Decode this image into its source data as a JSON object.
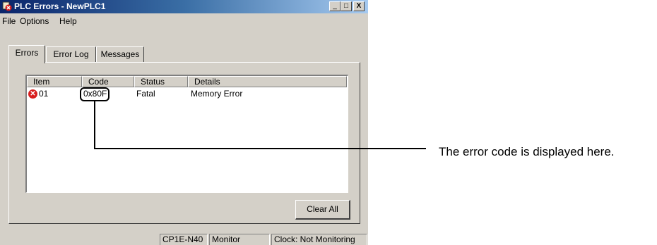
{
  "window": {
    "title": "PLC Errors - NewPLC1",
    "controls": [
      "_",
      "□",
      "X"
    ]
  },
  "menu": [
    "File",
    "Options",
    "Help"
  ],
  "tabs": [
    {
      "label": "Errors",
      "active": true
    },
    {
      "label": "Error Log",
      "active": false
    },
    {
      "label": "Messages",
      "active": false
    }
  ],
  "list": {
    "headers": [
      "Item",
      "Code",
      "Status",
      "Details"
    ],
    "rows": [
      {
        "icon": "error-x-icon",
        "item": "01",
        "code": "0x80F",
        "status": "Fatal",
        "details": "Memory Error"
      }
    ]
  },
  "buttons": {
    "clear_all": "Clear All"
  },
  "statusbar": [
    "CP1E-N40",
    "Monitor",
    "Clock: Not Monitoring"
  ],
  "annotation": "The error code is displayed here.",
  "colors": {
    "titlebar": "#0a246a",
    "face": "#d4d0c8",
    "error_icon": "#d81e1e"
  }
}
